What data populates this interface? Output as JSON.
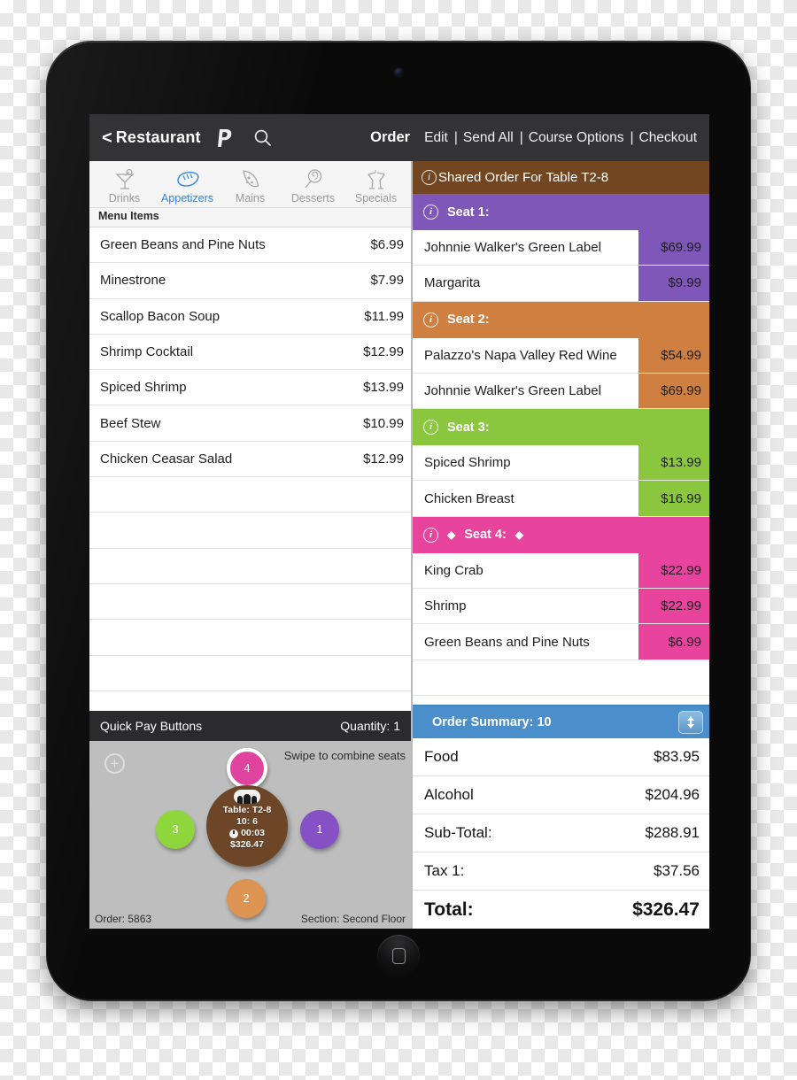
{
  "topbar": {
    "back_chevron": "<",
    "back_label": "Restaurant",
    "paypal_icon": "paypal-icon",
    "search_icon": "search-icon",
    "order_label": "Order",
    "actions": [
      "Edit",
      "Send All",
      "Course Options",
      "Checkout"
    ],
    "separator": "|"
  },
  "categories": [
    {
      "label": "Drinks",
      "icon": "cocktail-icon",
      "active": false
    },
    {
      "label": "Appetizers",
      "icon": "bread-icon",
      "active": true
    },
    {
      "label": "Mains",
      "icon": "pizza-icon",
      "active": false
    },
    {
      "label": "Desserts",
      "icon": "lollipop-icon",
      "active": false
    },
    {
      "label": "Specials",
      "icon": "cheers-icon",
      "active": false
    }
  ],
  "menu_items_header": "Menu Items",
  "menu_items": [
    {
      "name": "Green Beans and Pine Nuts",
      "price": "$6.99"
    },
    {
      "name": "Minestrone",
      "price": "$7.99"
    },
    {
      "name": "Scallop Bacon Soup",
      "price": "$11.99"
    },
    {
      "name": "Shrimp Cocktail",
      "price": "$12.99"
    },
    {
      "name": "Spiced Shrimp",
      "price": "$13.99"
    },
    {
      "name": "Beef Stew",
      "price": "$10.99"
    },
    {
      "name": "Chicken Ceasar Salad",
      "price": "$12.99"
    }
  ],
  "menu_empty_rows": 7,
  "quickpay": {
    "label": "Quick Pay Buttons",
    "quantity": "Quantity: 1"
  },
  "seatmap": {
    "add_icon": "plus-circle-icon",
    "swipe_hint": "Swipe to combine seats",
    "order_number": "Order: 5863",
    "section": "Section: Second Floor",
    "table": {
      "people_icon": "people-icon",
      "name": "Table: T2-8",
      "guests": "10: 6",
      "clock_icon": "clock-icon",
      "time": "00:03",
      "amount": "$326.47",
      "color": "#6d4527"
    },
    "dots": [
      {
        "number": "4",
        "color": "#e0439e",
        "selected": true
      },
      {
        "number": "3",
        "color": "#8ed63c",
        "selected": false
      },
      {
        "number": "1",
        "color": "#8551c4",
        "selected": false
      },
      {
        "number": "2",
        "color": "#dd9452",
        "selected": false
      }
    ]
  },
  "order": {
    "shared_header": "Shared Order For Table T2-8",
    "shared_color": "#714620",
    "info_glyph": "i",
    "diamond_glyph": "◆",
    "seats": [
      {
        "label": "Seat 1:",
        "color": "#7e57b8",
        "marked": false,
        "items": [
          {
            "name": "Johnnie Walker's Green Label",
            "price": "$69.99"
          },
          {
            "name": "Margarita",
            "price": "$9.99"
          }
        ]
      },
      {
        "label": "Seat 2:",
        "color": "#cf8040",
        "marked": false,
        "items": [
          {
            "name": "Palazzo's Napa Valley Red Wine",
            "price": "$54.99"
          },
          {
            "name": "Johnnie Walker's Green Label",
            "price": "$69.99"
          }
        ]
      },
      {
        "label": "Seat 3:",
        "color": "#8ac73f",
        "marked": false,
        "items": [
          {
            "name": "Spiced Shrimp",
            "price": "$13.99"
          },
          {
            "name": "Chicken Breast",
            "price": "$16.99"
          }
        ]
      },
      {
        "label": "Seat 4:",
        "color": "#e8449d",
        "marked": true,
        "items": [
          {
            "name": "King Crab",
            "price": "$22.99"
          },
          {
            "name": "Shrimp",
            "price": "$22.99"
          },
          {
            "name": "Green Beans and Pine Nuts",
            "price": "$6.99"
          }
        ]
      }
    ],
    "trailing_blank_rows": 2
  },
  "summary": {
    "title": "Order Summary: 10",
    "header_color": "#4a8fcc",
    "scroll_icon": "up-down-arrow-icon",
    "rows": [
      {
        "label": "Food",
        "value": "$83.95"
      },
      {
        "label": "Alcohol",
        "value": "$204.96"
      },
      {
        "label": "Sub-Total:",
        "value": "$288.91"
      },
      {
        "label": "Tax 1:",
        "value": "$37.56"
      },
      {
        "label": "Total:",
        "value": "$326.47"
      }
    ]
  }
}
